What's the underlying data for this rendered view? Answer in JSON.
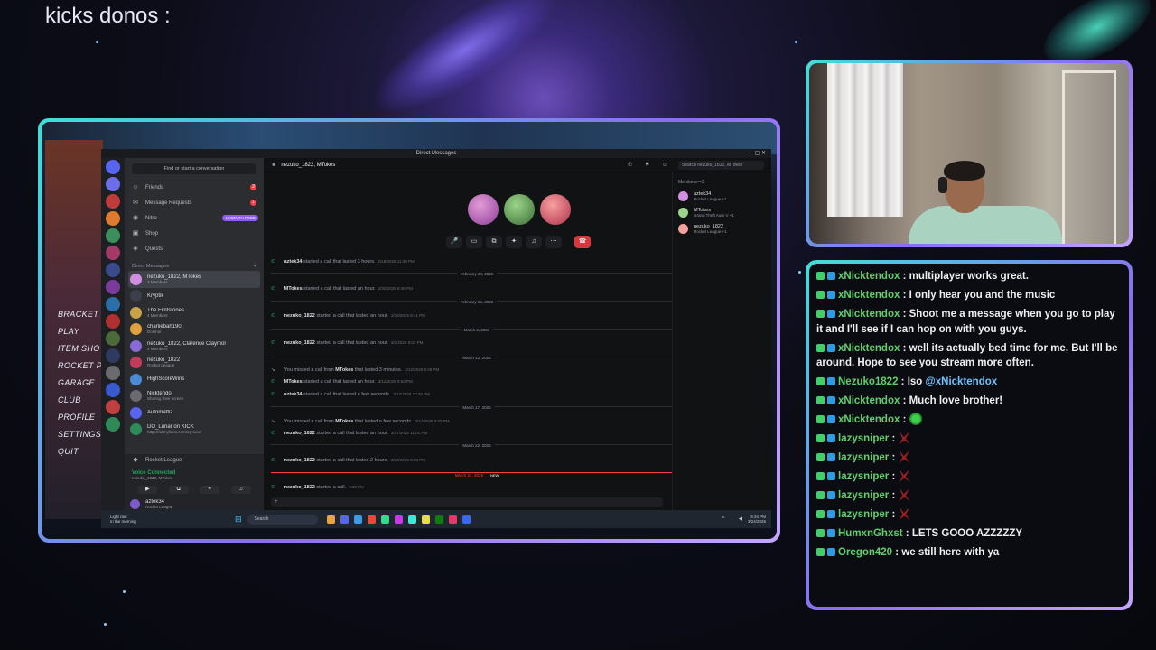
{
  "overlay": {
    "title": "kicks donos :"
  },
  "game": {
    "menu": [
      "BRACKET RI",
      "PLAY",
      "ITEM SHO",
      "ROCKET PA",
      "GARAGE",
      "CLUB",
      "PROFILE",
      "SETTINGS",
      "QUIT"
    ]
  },
  "discord": {
    "window_title": "Direct Messages",
    "find_placeholder": "Find or start a conversation",
    "nav": [
      {
        "label": "Friends",
        "badge": "2"
      },
      {
        "label": "Message Requests",
        "badge": "1"
      },
      {
        "label": "Nitro",
        "badge": "1 MONTH FREE"
      },
      {
        "label": "Shop"
      },
      {
        "label": "Quests"
      }
    ],
    "dm_header": "Direct Messages",
    "dms": [
      {
        "name": "nezuko_1822, MTokes",
        "sub": "3 Members"
      },
      {
        "name": "Kryptik",
        "sub": ""
      },
      {
        "name": "The Flintstones",
        "sub": "4 Members"
      },
      {
        "name": "charliebah190",
        "sub": "Dolphin"
      },
      {
        "name": "nezuko_1822, Clarence Claymor",
        "sub": "4 Members"
      },
      {
        "name": "nezuko_1822",
        "sub": "Rocket League"
      },
      {
        "name": "HighScoreWins",
        "sub": ""
      },
      {
        "name": "Nicktendo",
        "sub": "Sharing their screen"
      },
      {
        "name": "Automattiz",
        "sub": ""
      },
      {
        "name": "DO_Lunar on KICK",
        "sub": "https://allmylinks.com/og-lunar"
      }
    ],
    "server_label": "Rocket League",
    "voice": {
      "status": "Voice Connected",
      "channel": "nezuko_1822, MTokes"
    },
    "user": {
      "name": "aztek34",
      "sub": "Rocket League"
    },
    "chat_header": "nezuko_1822, MTokes",
    "header_search": "Search nezuko_1822, MTokes",
    "log": [
      {
        "kind": "call",
        "user": "aztek34",
        "text": "started a call that lasted 3 hours.",
        "ts": "2/19/2026 11:38 PM"
      },
      {
        "kind": "date",
        "text": "February 20, 2026"
      },
      {
        "kind": "call",
        "user": "MTokes",
        "text": "started a call that lasted an hour.",
        "ts": "2/20/2026 8:46 PM"
      },
      {
        "kind": "date",
        "text": "February 26, 2026"
      },
      {
        "kind": "call",
        "user": "nezuko_1822",
        "text": "started a call that lasted an hour.",
        "ts": "2/26/2026 9:41 PM"
      },
      {
        "kind": "date",
        "text": "March 2, 2026"
      },
      {
        "kind": "call",
        "user": "nezuko_1822",
        "text": "started a call that lasted an hour.",
        "ts": "3/2/2026 9:02 PM"
      },
      {
        "kind": "date",
        "text": "March 12, 2026"
      },
      {
        "kind": "missed",
        "user": "MTokes",
        "text": "You missed a call from",
        "after": "that lasted 3 minutes.",
        "ts": "3/12/2026 9:49 PM"
      },
      {
        "kind": "call",
        "user": "MTokes",
        "text": "started a call that lasted an hour.",
        "ts": "3/12/2026 9:53 PM"
      },
      {
        "kind": "call",
        "user": "aztek34",
        "text": "started a call that lasted a few seconds.",
        "ts": "3/12/2026 10:25 PM"
      },
      {
        "kind": "date",
        "text": "March 17, 2026"
      },
      {
        "kind": "missed",
        "user": "MTokes",
        "text": "You missed a call from",
        "after": "that lasted a few seconds.",
        "ts": "3/17/2026 9:00 PM"
      },
      {
        "kind": "call",
        "user": "nezuko_1822",
        "text": "started a call that lasted an hour.",
        "ts": "3/17/2026 11:01 PM"
      },
      {
        "kind": "date",
        "text": "March 22, 2026"
      },
      {
        "kind": "call",
        "user": "nezuko_1822",
        "text": "started a call that lasted 2 hours.",
        "ts": "3/22/2026 9:08 PM"
      },
      {
        "kind": "new",
        "text": "March 24, 2026",
        "pill": "NEW"
      },
      {
        "kind": "call",
        "user": "nezuko_1822",
        "text": "started a call.",
        "ts": "9:20 PM"
      }
    ],
    "members_header": "Members—3",
    "members": [
      {
        "name": "aztek34",
        "sub": "Rocket League +1"
      },
      {
        "name": "MTokes",
        "sub": "Grand Theft Auto V +1"
      },
      {
        "name": "nezuko_1822",
        "sub": "Rocket League +1"
      }
    ]
  },
  "taskbar": {
    "weather_line1": "Light rain",
    "weather_line2": "In the morning",
    "search": "Search",
    "time": "9:34 PM",
    "date": "3/24/2026"
  },
  "chat": {
    "messages": [
      {
        "user": "xNicktendox",
        "text": "multiplayer works great."
      },
      {
        "user": "xNicktendox",
        "text": "I only hear you and the music"
      },
      {
        "user": "xNicktendox",
        "text": "Shoot me a message when you go to play it and I'll see if I can hop on with you guys."
      },
      {
        "user": "xNicktendox",
        "text": "well its actually bed time for me. But I'll be around. Hope to see you stream more often."
      },
      {
        "user": "Nezuko1822",
        "text": "Iso",
        "mention": "@xNicktendox"
      },
      {
        "user": "xNicktendox",
        "text": "Much love brother!"
      },
      {
        "user": "xNicktendox",
        "text": "",
        "emote": "green"
      },
      {
        "user": "lazysniper",
        "text": "",
        "emote": "red"
      },
      {
        "user": "lazysniper",
        "text": "",
        "emote": "red"
      },
      {
        "user": "lazysniper",
        "text": "",
        "emote": "red"
      },
      {
        "user": "lazysniper",
        "text": "",
        "emote": "red"
      },
      {
        "user": "lazysniper",
        "text": "",
        "emote": "red"
      },
      {
        "user": "HumxnGhxst",
        "text": "LETS GOOO AZZZZZY"
      },
      {
        "user": "Oregon420",
        "text": "we still here with ya"
      }
    ]
  },
  "colors": {
    "frame_start": "#3fe0d8",
    "frame_end": "#8a6df0",
    "chat_user": "#5fcf6a",
    "discord_green": "#23a55a"
  }
}
